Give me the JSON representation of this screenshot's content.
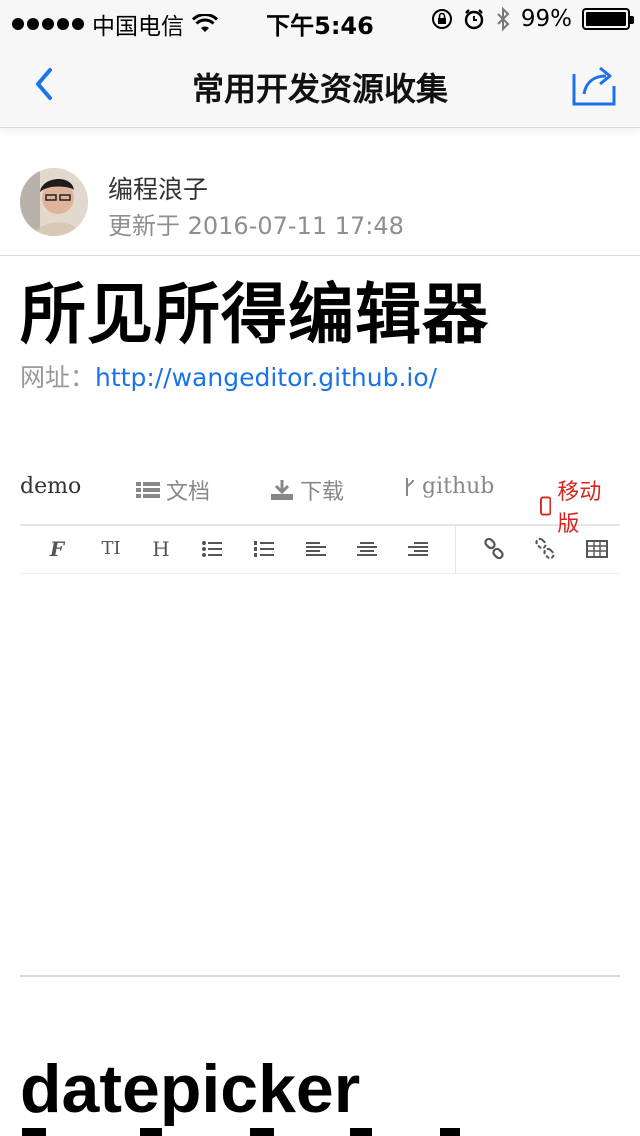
{
  "status_bar": {
    "carrier": "中国电信",
    "time": "下午5:46",
    "battery": "99%",
    "battery_level": 0.99
  },
  "nav": {
    "title": "常用开发资源收集",
    "back_icon": "chevron-left-icon",
    "share_icon": "share-icon",
    "accent": "#1a73e8"
  },
  "author": {
    "name": "编程浪子",
    "updated": "更新于 2016-07-11 17:48"
  },
  "article": {
    "heading": "所见所得编辑器",
    "url_label": "网址：",
    "url": "http://wangeditor.github.io/",
    "embedded_tabs": [
      {
        "label": "demo",
        "icon": ""
      },
      {
        "label": "文档",
        "icon": "list-icon"
      },
      {
        "label": "下载",
        "icon": "download-icon"
      },
      {
        "label": "github",
        "icon": "branch-icon"
      },
      {
        "label": "移动版",
        "icon": "phone-icon"
      }
    ],
    "embedded_tools": [
      {
        "glyph": "F"
      },
      {
        "glyph": "TI"
      },
      {
        "glyph": "H"
      }
    ],
    "next_heading": "datepicker"
  }
}
